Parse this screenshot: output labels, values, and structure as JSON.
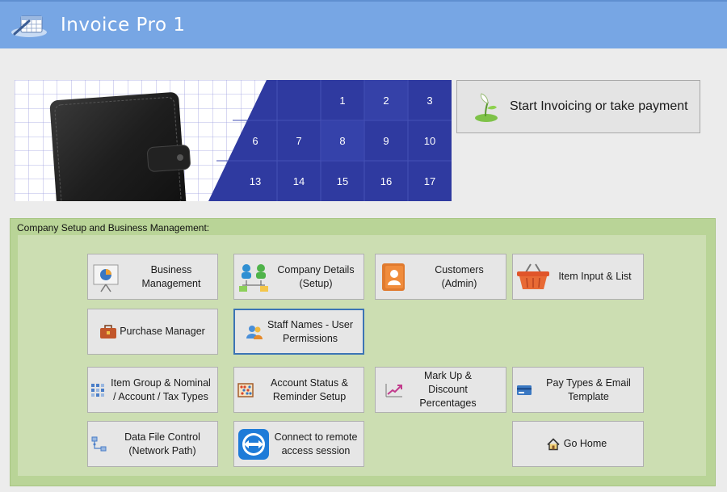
{
  "app": {
    "title": "Invoice Pro 1",
    "logo_icon": "calendar-pen-icon"
  },
  "banner": {
    "calendar_days": [
      "1",
      "2",
      "3",
      "6",
      "7",
      "8",
      "9",
      "10",
      "13",
      "14",
      "15",
      "16",
      "17"
    ],
    "calendar_color": "#2f3aa0"
  },
  "start": {
    "label": "Start Invoicing or take payment",
    "icon": "sprout-icon"
  },
  "panel": {
    "title": "Company Setup and Business Management:",
    "color": "#b9d497"
  },
  "buttons": {
    "business_management": {
      "label": "Business\nManagement",
      "icon": "presentation-chart-icon"
    },
    "company_details": {
      "label": "Company Details\n(Setup)",
      "icon": "org-people-icon"
    },
    "customers": {
      "label": "Customers\n(Admin)",
      "icon": "address-book-icon"
    },
    "item_input": {
      "label": "Item Input & List",
      "icon": "basket-icon"
    },
    "purchase_manager": {
      "label": "Purchase Manager",
      "icon": "briefcase-icon"
    },
    "staff_names": {
      "label": "Staff Names - User\nPermissions",
      "icon": "users-icon"
    },
    "item_group": {
      "label": "Item Group & Nominal\n/ Account / Tax Types",
      "icon": "grid-icon"
    },
    "account_status": {
      "label": "Account Status &\nReminder Setup",
      "icon": "abacus-icon"
    },
    "markup": {
      "label": "Mark Up & Discount\nPercentages",
      "icon": "trend-up-icon"
    },
    "pay_types": {
      "label": "Pay Types & Email\nTemplate",
      "icon": "credit-card-icon"
    },
    "data_file": {
      "label": "Data File Control\n(Network Path)",
      "icon": "network-icon"
    },
    "remote": {
      "label": "Connect to remote\naccess session",
      "icon": "remote-arrows-icon"
    },
    "go_home": {
      "label": "Go Home",
      "icon": "home-icon"
    }
  }
}
